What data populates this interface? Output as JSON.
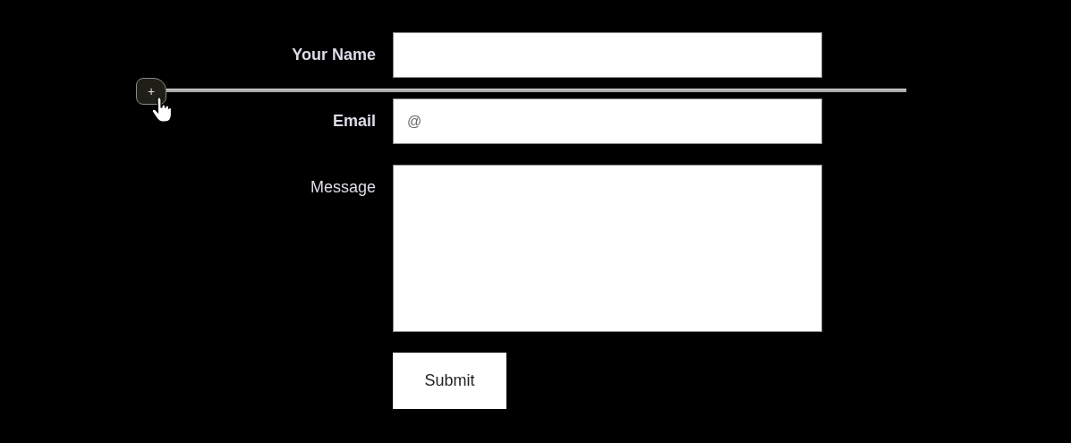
{
  "fields": [
    {
      "label": "Your Name",
      "emphasized": true,
      "kind": "input"
    },
    {
      "label": "Email",
      "emphasized": true,
      "kind": "input",
      "placeholder": "@"
    },
    {
      "label": "Message",
      "emphasized": false,
      "kind": "textarea"
    }
  ],
  "insert_handle": {
    "symbol": "+"
  },
  "submit": {
    "label": "Submit"
  }
}
